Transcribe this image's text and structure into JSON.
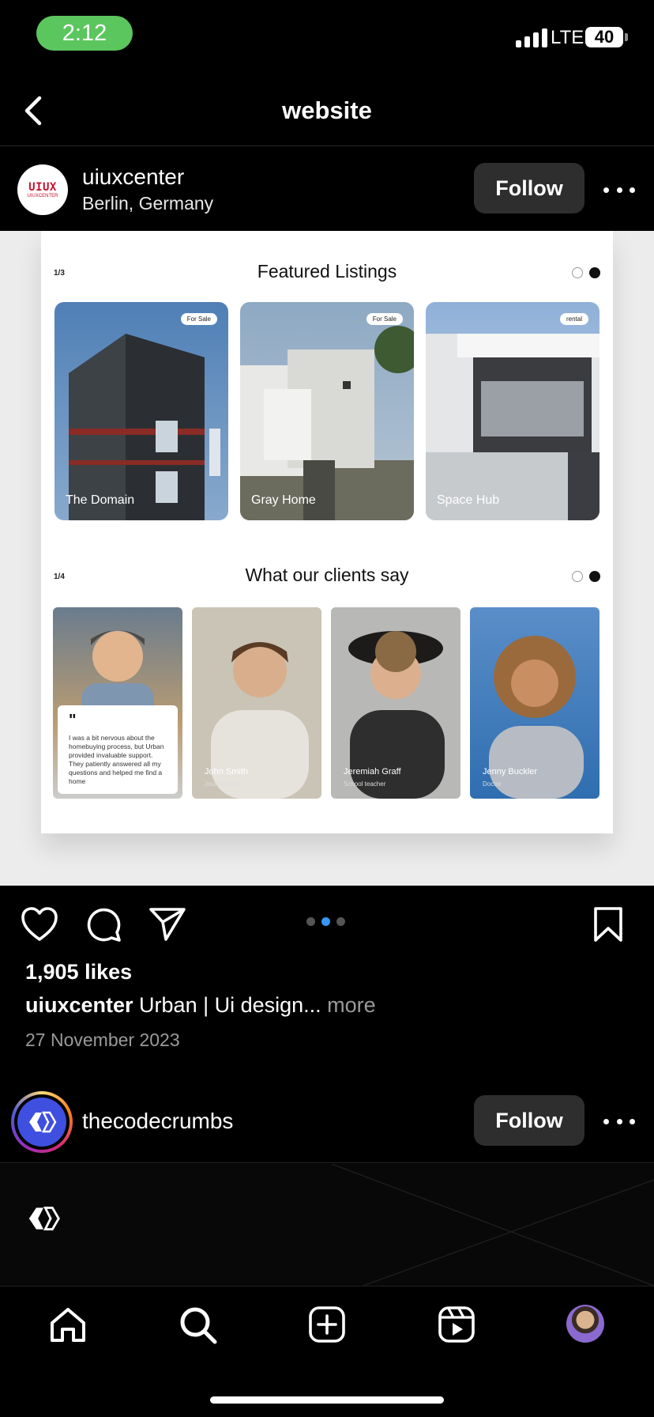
{
  "status_bar": {
    "time": "2:12",
    "network": "LTE",
    "battery": "40"
  },
  "nav": {
    "title": "website",
    "back_icon": "chevron-left-icon"
  },
  "post": {
    "username": "uiuxcenter",
    "location": "Berlin, Germany",
    "follow_label": "Follow",
    "avatar_text": "UIUX",
    "avatar_subtext": "UIUXCENTER",
    "image": {
      "listings_counter": "1/3",
      "listings_title": "Featured Listings",
      "listings": [
        {
          "tag": "For Sale",
          "name": "The Domain"
        },
        {
          "tag": "For Sale",
          "name": "Gray Home"
        },
        {
          "tag": "rental",
          "name": "Space Hub"
        }
      ],
      "clients_counter": "1/4",
      "clients_title": "What our clients say",
      "quote": "I was a bit nervous about the homebuying process, but Urban provided invaluable support. They patiently answered all my questions and helped me find a home",
      "clients": [
        {
          "name": "John Smith",
          "role": "Journeyman"
        },
        {
          "name": "Jeremiah Graff",
          "role": "School teacher"
        },
        {
          "name": "Jenny Buckler",
          "role": "Doctor"
        }
      ]
    },
    "carousel": {
      "count": 3,
      "active": 1
    },
    "likes": "1,905 likes",
    "caption_user": "uiuxcenter",
    "caption_text": " Urban | Ui design...",
    "caption_more": " more",
    "date": "27 November 2023"
  },
  "post2": {
    "username": "thecodecrumbs",
    "follow_label": "Follow"
  },
  "tabbar": [
    "home-icon",
    "search-icon",
    "create-icon",
    "reels-icon",
    "profile-avatar"
  ],
  "colors": {
    "follow_bg": "#2e2e2e",
    "active_dot": "#3797f0",
    "time_pill": "#5bc65e"
  }
}
